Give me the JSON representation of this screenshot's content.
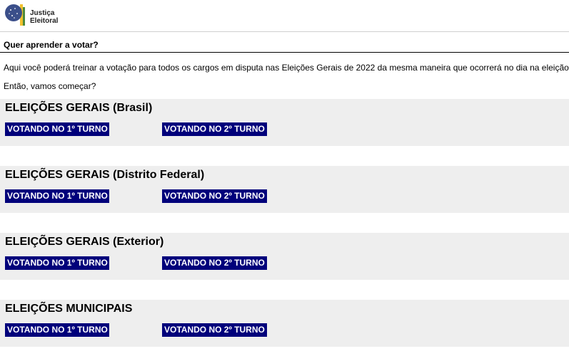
{
  "header": {
    "logo_line1": "Justiça",
    "logo_line2": "Eleitoral",
    "colors": {
      "blue": "#3b4f8a",
      "yellow": "#f2c12e",
      "green": "#4d8a3c"
    }
  },
  "main": {
    "title": "Quer aprender a votar?",
    "intro": "Aqui você poderá treinar a votação para todos os cargos em disputa nas Eleições Gerais de 2022 da mesma maneira que ocorrerá no dia na eleição.",
    "prompt": "Então, vamos começar?",
    "button_color": "#00007b",
    "blocks": [
      {
        "title": "ELEIÇÕES GERAIS (Brasil)",
        "first_turn": "VOTANDO NO 1º TURNO",
        "second_turn": "VOTANDO NO 2º TURNO"
      },
      {
        "title": "ELEIÇÕES GERAIS (Distrito Federal)",
        "first_turn": "VOTANDO NO 1º TURNO",
        "second_turn": "VOTANDO NO 2º TURNO"
      },
      {
        "title": "ELEIÇÕES GERAIS (Exterior)",
        "first_turn": "VOTANDO NO 1º TURNO",
        "second_turn": "VOTANDO NO 2º TURNO"
      },
      {
        "title": "ELEIÇÕES MUNICIPAIS",
        "first_turn": "VOTANDO NO 1º TURNO",
        "second_turn": "VOTANDO NO 2º TURNO"
      }
    ]
  }
}
